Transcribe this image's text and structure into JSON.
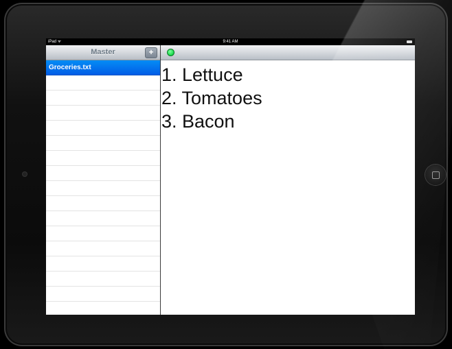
{
  "status_bar": {
    "carrier": "iPad ᯤ",
    "time": "9:41 AM"
  },
  "master": {
    "title": "Master",
    "add_label": "+",
    "files": [
      {
        "name": "Groceries.txt",
        "selected": true
      },
      {
        "name": ""
      },
      {
        "name": ""
      },
      {
        "name": ""
      },
      {
        "name": ""
      },
      {
        "name": ""
      },
      {
        "name": ""
      },
      {
        "name": ""
      },
      {
        "name": ""
      },
      {
        "name": ""
      },
      {
        "name": ""
      },
      {
        "name": ""
      },
      {
        "name": ""
      },
      {
        "name": ""
      },
      {
        "name": ""
      },
      {
        "name": ""
      },
      {
        "name": ""
      }
    ]
  },
  "detail": {
    "status_color": "#1ed84f",
    "lines": [
      "1. Lettuce",
      "2. Tomatoes",
      "3. Bacon"
    ]
  }
}
